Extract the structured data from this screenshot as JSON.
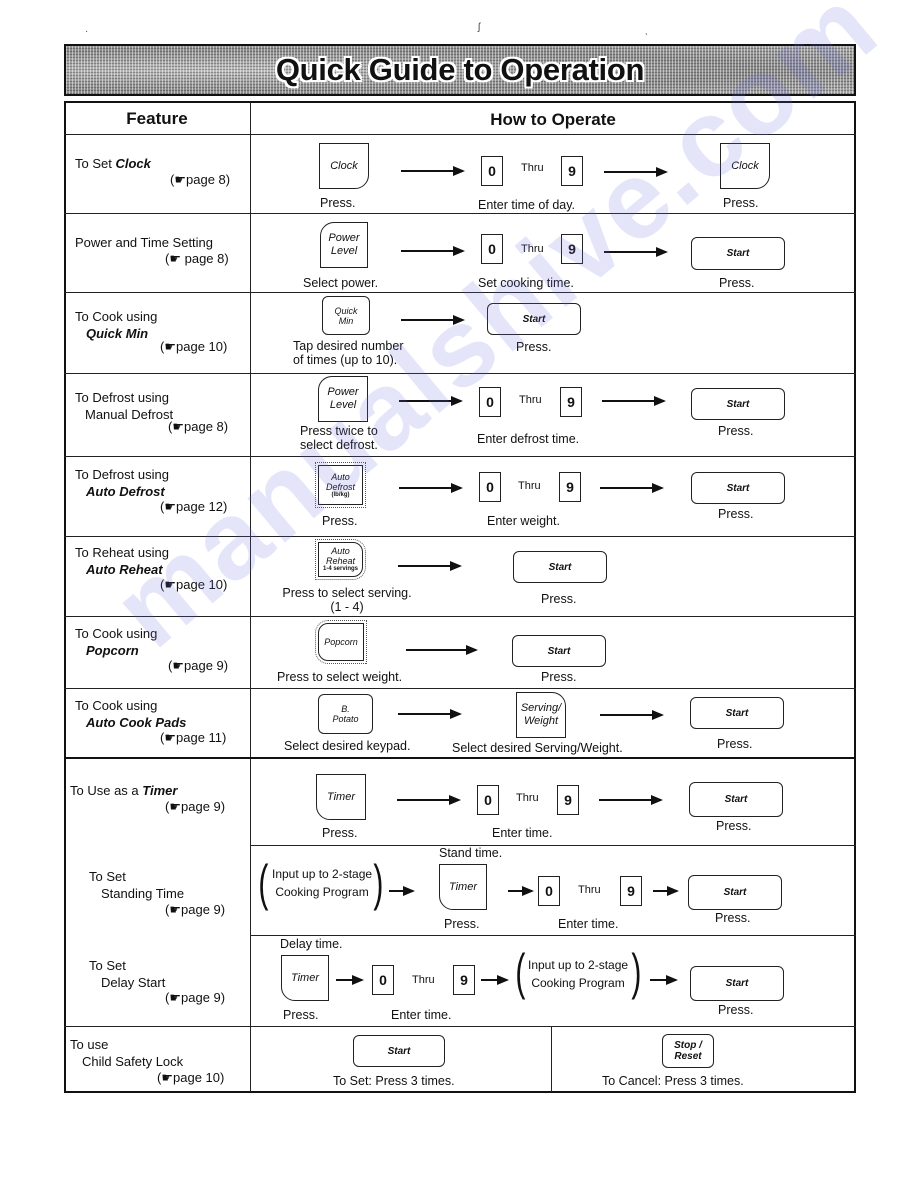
{
  "page": {
    "title": "Quick Guide to Operation",
    "watermark": "manualshive.com",
    "stray_marks": [
      "·",
      "ʃ",
      "ˎ"
    ]
  },
  "table": {
    "headers": {
      "feature": "Feature",
      "how": "How to Operate"
    },
    "page_ref_icon": "☛",
    "rows": [
      {
        "feature_prefix": "To Set ",
        "feature_em": "Clock",
        "feature_line2": "",
        "page_ref": "page 8)",
        "keys": {
          "first": "Clock",
          "num0": "0",
          "thru": "Thru",
          "num9": "9",
          "last": "Clock"
        },
        "captions": [
          "Press.",
          "Enter time of day.",
          "Press."
        ]
      },
      {
        "feature_line1": "Power and Time Setting",
        "page_ref": " page 8)",
        "keys": {
          "first_l1": "Power",
          "first_l2": "Level",
          "num0": "0",
          "thru": "Thru",
          "num9": "9",
          "last": "Start"
        },
        "captions": [
          "Select power.",
          "Set cooking time.",
          "Press."
        ]
      },
      {
        "feature_line1": "To Cook using",
        "feature_em": "Quick Min",
        "page_ref": "page 10)",
        "keys": {
          "first_l1": "Quick",
          "first_l2": "Min",
          "last": "Start"
        },
        "captions": [
          "Tap desired number",
          "of times (up to 10).",
          "Press."
        ]
      },
      {
        "feature_line1": "To Defrost using",
        "feature_line2": "Manual Defrost",
        "page_ref": "page 8)",
        "keys": {
          "first_l1": "Power",
          "first_l2": "Level",
          "num0": "0",
          "thru": "Thru",
          "num9": "9",
          "last": "Start"
        },
        "captions": [
          "Press twice to",
          "select defrost.",
          "Enter defrost time.",
          "Press."
        ]
      },
      {
        "feature_line1": "To Defrost using",
        "feature_em": "Auto Defrost",
        "page_ref": "page 12)",
        "keys": {
          "first_l1": "Auto",
          "first_l2": "Defrost",
          "first_l3": "(lb/kg)",
          "num0": "0",
          "thru": "Thru",
          "num9": "9",
          "last": "Start"
        },
        "captions": [
          "Press.",
          "Enter weight.",
          "Press."
        ]
      },
      {
        "feature_line1": "To Reheat using",
        "feature_em": "Auto Reheat",
        "page_ref": "page 10)",
        "keys": {
          "first_l1": "Auto",
          "first_l2": "Reheat",
          "first_l3": "1-4 servings",
          "last": "Start"
        },
        "captions": [
          "Press to select serving.",
          "(1 - 4)",
          "Press."
        ]
      },
      {
        "feature_line1": "To Cook using",
        "feature_em": "Popcorn",
        "page_ref": "page 9)",
        "keys": {
          "first": "Popcorn",
          "last": "Start"
        },
        "captions": [
          "Press to select weight.",
          "Press."
        ]
      },
      {
        "feature_line1": "To Cook using",
        "feature_em": "Auto Cook Pads",
        "page_ref": "page 11)",
        "keys": {
          "first_l1": "B.",
          "first_l2": "Potato",
          "mid_l1": "Serving/",
          "mid_l2": "Weight",
          "last": "Start"
        },
        "captions": [
          "Select desired keypad.",
          "Select desired Serving/Weight.",
          "Press."
        ]
      },
      {
        "feature_prefix": "To Use as a ",
        "feature_em": "Timer",
        "page_ref": "page 9)",
        "keys": {
          "first": "Timer",
          "num0": "0",
          "thru": "Thru",
          "num9": "9",
          "last": "Start"
        },
        "captions": [
          "Press.",
          "Enter time.",
          "Press."
        ]
      },
      {
        "feature_line1": "To Set",
        "feature_line2": "Standing Time",
        "page_ref": "page 9)",
        "top_label": "Stand time.",
        "bracket": [
          "Input up to 2-stage",
          "Cooking Program"
        ],
        "keys": {
          "first": "Timer",
          "num0": "0",
          "thru": "Thru",
          "num9": "9",
          "last": "Start"
        },
        "captions": [
          "Press.",
          "Enter time.",
          "Press."
        ]
      },
      {
        "feature_line1": "To Set",
        "feature_line2": "Delay Start",
        "page_ref": "page 9)",
        "top_label": "Delay time.",
        "bracket": [
          "Input up to 2-stage",
          "Cooking Program"
        ],
        "keys": {
          "first": "Timer",
          "num0": "0",
          "thru": "Thru",
          "num9": "9",
          "last": "Start"
        },
        "captions": [
          "Press.",
          "Enter time.",
          "Press."
        ]
      },
      {
        "feature_line1": "To use",
        "feature_line2": "Child Safety Lock",
        "page_ref": "page 10)",
        "keys": {
          "set": "Start",
          "cancel_l1": "Stop /",
          "cancel_l2": "Reset"
        },
        "captions": [
          "To Set: Press 3 times.",
          "To Cancel: Press 3 times."
        ]
      }
    ]
  }
}
